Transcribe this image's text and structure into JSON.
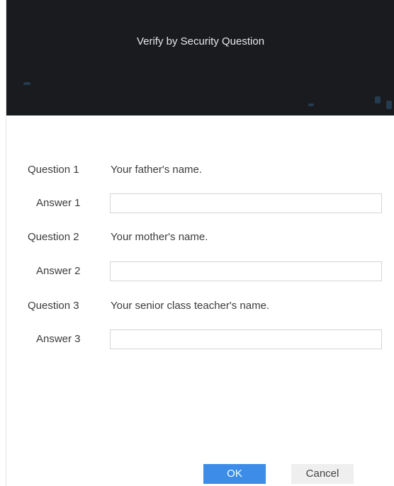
{
  "dialog": {
    "title": "Verify by Security Question"
  },
  "questions": [
    {
      "question_label": "Question 1",
      "question_text": "Your father's name.",
      "answer_label": "Answer 1",
      "answer_value": ""
    },
    {
      "question_label": "Question 2",
      "question_text": "Your mother's name.",
      "answer_label": "Answer 2",
      "answer_value": ""
    },
    {
      "question_label": "Question 3",
      "question_text": "Your senior class teacher's name.",
      "answer_label": "Answer 3",
      "answer_value": ""
    }
  ],
  "buttons": {
    "ok_label": "OK",
    "cancel_label": "Cancel"
  },
  "colors": {
    "header_background": "#191b1f",
    "primary_button": "#3c8ce8",
    "secondary_button": "#efefef"
  }
}
